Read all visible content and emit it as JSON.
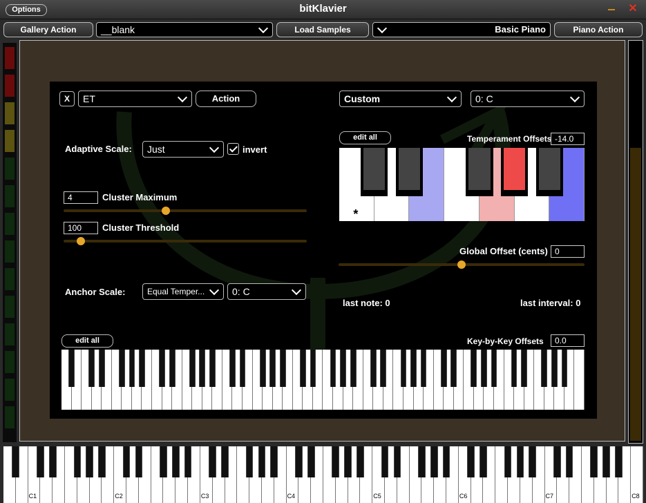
{
  "window": {
    "title": "bitKlavier",
    "options_label": "Options"
  },
  "toolbar": {
    "gallery_action": "Gallery Action",
    "gallery_name": "__blank",
    "load_samples": "Load Samples",
    "piano_name": "Basic Piano",
    "piano_action": "Piano Action"
  },
  "tuning": {
    "close_label": "X",
    "preset": "ET",
    "action_label": "Action",
    "scale": "Custom",
    "fundamental": "0: C",
    "adaptive_scale_label": "Adaptive Scale:",
    "adaptive_scale": "Just",
    "invert_label": "invert",
    "invert_checked": true,
    "cluster_max_value": "4",
    "cluster_max_label": "Cluster Maximum",
    "cluster_max_slider": 0.42,
    "cluster_threshold_value": "100",
    "cluster_threshold_label": "Cluster Threshold",
    "cluster_threshold_slider": 0.07,
    "anchor_scale_label": "Anchor Scale:",
    "anchor_scale": "Equal Temper...",
    "anchor_fundamental": "0: C",
    "edit_all_label": "edit all",
    "temperament_offsets_label": "Temperament Offsets",
    "temperament_offsets_value": "-14.0",
    "octave_marker": "*",
    "global_offset_label": "Global Offset (cents)",
    "global_offset_value": "0",
    "global_offset_slider": 0.5,
    "last_note_label": "last note: 0",
    "last_interval_label": "last interval: 0",
    "key_offsets_edit_label": "edit all",
    "key_offsets_label": "Key-by-Key Offsets",
    "key_offsets_value": "0.0"
  },
  "octave_keyboard": {
    "white_colors": [
      "#ffffff",
      "#ffffff",
      "#a8a8f2",
      "#ffffff",
      "#f2b0b0",
      "#ffffff",
      "#7070f5"
    ],
    "black_colors": [
      "#444444",
      "#444444",
      "#444444",
      "#ef4a4a",
      "#444444"
    ]
  },
  "main_keyboard": {
    "octave_labels": [
      "C1",
      "C2",
      "C3",
      "C4",
      "C5",
      "C6",
      "C7",
      "C8"
    ]
  },
  "colors": {
    "accent": "#e7a72a",
    "panel": "#3b3125"
  }
}
